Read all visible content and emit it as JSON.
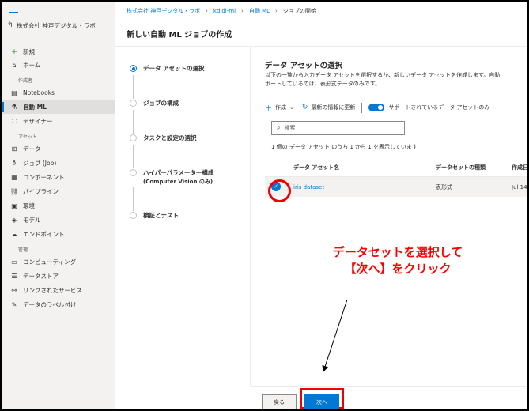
{
  "workspace": {
    "name": "株式会社 神戸デジタル・ラボ"
  },
  "breadcrumb": {
    "items": [
      "株式会社 神戸デジタル・ラボ",
      "kdldi-ml",
      "自動 ML"
    ],
    "current": "ジョブの開始"
  },
  "sidebar": {
    "new_label": "新規",
    "home_label": "ホーム",
    "section_authoring": "作成者",
    "notebooks_label": "Notebooks",
    "automl_label": "自動 ML",
    "designer_label": "デザイナー",
    "section_assets": "アセット",
    "data_label": "データ",
    "jobs_label": "ジョブ (Job)",
    "components_label": "コンポーネント",
    "pipelines_label": "パイプライン",
    "environments_label": "環境",
    "models_label": "モデル",
    "endpoints_label": "エンドポイント",
    "section_manage": "管理",
    "compute_label": "コンピューティング",
    "datastores_label": "データストア",
    "linked_label": "リンクされたサービス",
    "labeling_label": "データのラベル付け"
  },
  "page": {
    "title": "新しい自動 ML ジョブの作成"
  },
  "steps": {
    "s1": "データ アセットの選択",
    "s2": "ジョブの構成",
    "s3": "タスクと設定の選択",
    "s4_line1": "ハイパーパラメーター構成",
    "s4_line2": "(Computer Vision のみ)",
    "s5": "検証とテスト"
  },
  "main": {
    "title": "データ アセットの選択",
    "desc_line1": "以下の一覧から入力データ アセットを選択するか、新しいデータ アセットを作成します。自動",
    "desc_line2": "ポートしているのは、表形式データのみです。",
    "toolbar": {
      "create_label": "作成",
      "refresh_label": "最新の情報に更新",
      "toggle_label": "サポートされているデータ アセットのみ"
    },
    "search_placeholder": "検索",
    "count_text": "1 個の データ アセット のうち 1 から 1 を表示しています",
    "table": {
      "headers": [
        "データ アセット名",
        "データセットの種類",
        "作成日"
      ],
      "rows": [
        {
          "name": "iris dataset",
          "type": "表形式",
          "date": "Jul 14"
        }
      ]
    }
  },
  "annotation": {
    "line1": "データセットを選択して",
    "line2": "【次へ】をクリック"
  },
  "footer": {
    "back_label": "戻る",
    "next_label": "次へ"
  },
  "colors": {
    "accent": "#0078d4",
    "annotation": "#ff0000"
  }
}
